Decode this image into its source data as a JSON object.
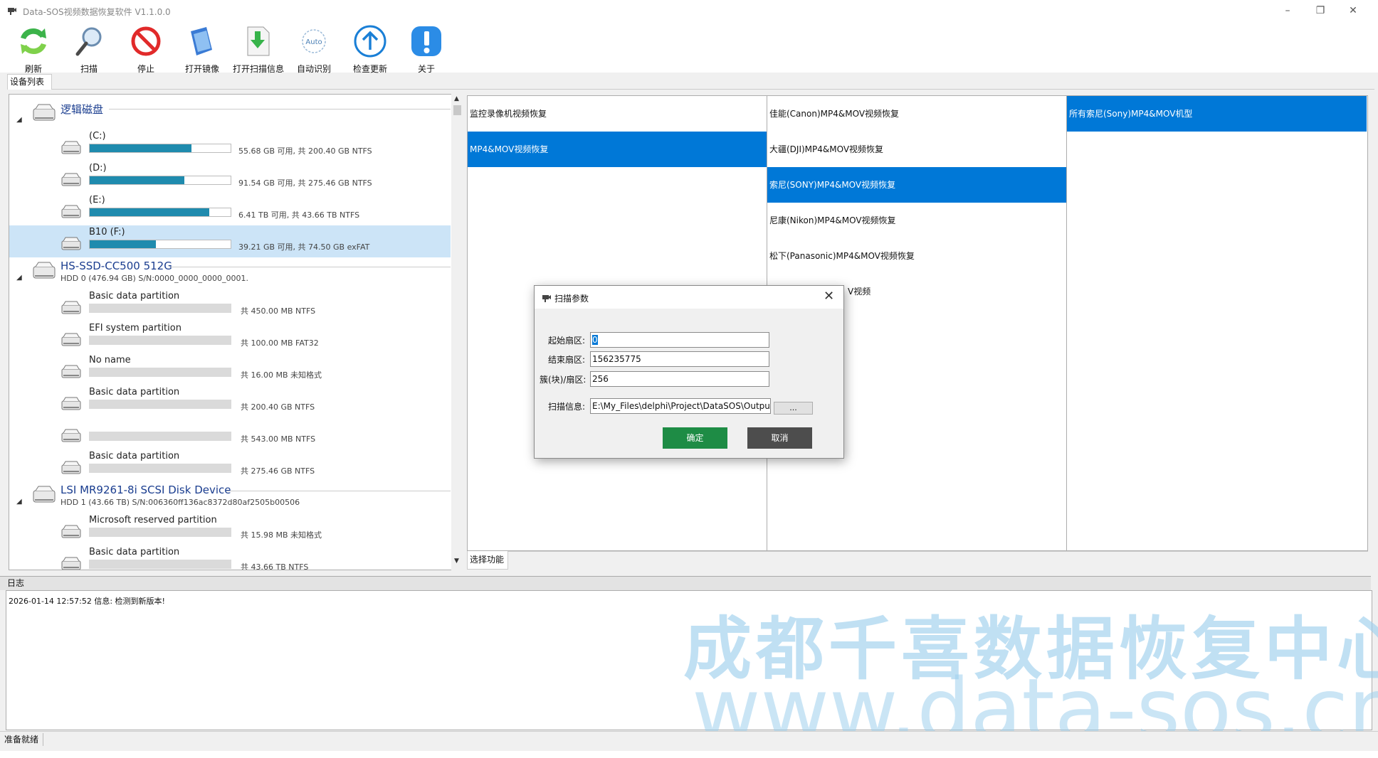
{
  "window": {
    "title": "Data-SOS视频数据恢复软件 V1.1.0.0",
    "min": "–",
    "restore": "❐",
    "close": "✕"
  },
  "toolbar": [
    {
      "label": "刷新",
      "icon": "refresh-icon"
    },
    {
      "label": "扫描",
      "icon": "magnifier-icon"
    },
    {
      "label": "停止",
      "icon": "stop-icon"
    },
    {
      "label": "打开镜像",
      "icon": "open-image-icon"
    },
    {
      "label": "打开扫描信息",
      "icon": "open-scan-info-icon"
    },
    {
      "label": "自动识别",
      "icon": "auto-icon"
    },
    {
      "label": "检查更新",
      "icon": "update-arrow-icon"
    },
    {
      "label": "关于",
      "icon": "info-exclamation-icon"
    }
  ],
  "auto_icon_text": "Auto",
  "device_tab": "设备列表",
  "tree": {
    "groups": [
      {
        "name": "逻辑磁盘",
        "sub": ""
      },
      {
        "name": "HS-SSD-CC500 512G",
        "sub": "HDD 0 (476.94 GB) S/N:0000_0000_0000_0001."
      },
      {
        "name": "LSI MR9261-8i SCSI Disk Device",
        "sub": "HDD 1 (43.66 TB) S/N:006360ff136ac8372d80af2505b00506"
      }
    ],
    "partitions": [
      {
        "name": "(C:)",
        "info": "55.68 GB 可用, 共 200.40 GB NTFS",
        "used": 0.72
      },
      {
        "name": "(D:)",
        "info": "91.54 GB 可用, 共 275.46 GB NTFS",
        "used": 0.67
      },
      {
        "name": "(E:)",
        "info": "6.41 TB 可用, 共 43.66 TB NTFS",
        "used": 0.85
      },
      {
        "name": "B10 (F:)",
        "info": "39.21 GB 可用, 共 74.50 GB exFAT",
        "used": 0.47
      },
      {
        "name": "Basic data partition",
        "info": "共 450.00 MB NTFS"
      },
      {
        "name": "EFI system partition",
        "info": "共 100.00 MB FAT32"
      },
      {
        "name": "No name",
        "info": "共 16.00 MB 未知格式"
      },
      {
        "name": "Basic data partition",
        "info": "共 200.40 GB NTFS"
      },
      {
        "name": "",
        "info": "共 543.00 MB NTFS"
      },
      {
        "name": "Basic data partition",
        "info": "共 275.46 GB NTFS"
      },
      {
        "name": "Microsoft reserved partition",
        "info": "共 15.98 MB 未知格式"
      },
      {
        "name": "Basic data partition",
        "info": "共 43.66 TB NTFS"
      }
    ]
  },
  "functions": {
    "col1": [
      "监控录像机视频恢复",
      "MP4&MOV视频恢复"
    ],
    "col2": [
      "佳能(Canon)MP4&MOV视频恢复",
      "大疆(DJI)MP4&MOV视频恢复",
      "索尼(SONY)MP4&MOV视频恢复",
      "尼康(Nikon)MP4&MOV视频恢复",
      "松下(Panasonic)MP4&MOV视频恢复",
      "V视频"
    ],
    "col3": [
      "所有索尼(Sony)MP4&MOV机型"
    ]
  },
  "func_tab": "选择功能",
  "log": {
    "header": "日志",
    "lines": [
      "2026-01-14 12:57:52 信息: 检测到新版本!"
    ]
  },
  "watermark": {
    "line1": "成都千喜数据恢复中心",
    "line2": "www.data-sos.cn"
  },
  "status": "准备就绪",
  "dialog": {
    "title": "扫描参数",
    "close": "✕",
    "start_label": "起始扇区:",
    "start_value": "0",
    "end_label": "结束扇区:",
    "end_value": "156235775",
    "cluster_label": "簇(块)/扇区:",
    "cluster_value": "256",
    "info_label": "扫描信息:",
    "info_value": "E:\\My_Files\\delphi\\Project\\DataSOS\\Output",
    "browse": "...",
    "ok": "确定",
    "cancel": "取消"
  },
  "colors": {
    "selection": "#0078d7",
    "progress": "#1f8bae",
    "ok": "#1e8c45",
    "cancel": "#4d4d4d",
    "group_title": "#1a3d8f"
  }
}
